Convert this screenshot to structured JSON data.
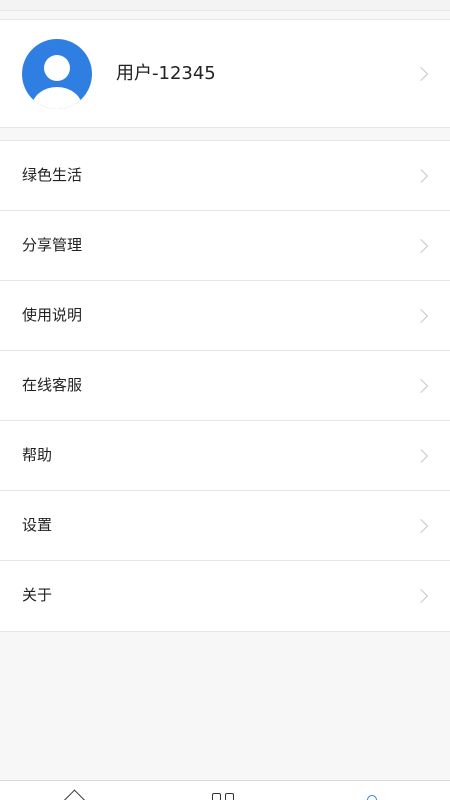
{
  "profile": {
    "username": "用户-12345",
    "avatar_color": "#2f7fe3"
  },
  "menu": {
    "items": [
      {
        "label": "绿色生活"
      },
      {
        "label": "分享管理"
      },
      {
        "label": "使用说明"
      },
      {
        "label": "在线客服"
      },
      {
        "label": "帮助"
      },
      {
        "label": "设置"
      },
      {
        "label": "关于"
      }
    ]
  },
  "tabbar": {
    "tabs": [
      {
        "icon": "home-icon"
      },
      {
        "icon": "category-icon"
      },
      {
        "icon": "profile-icon",
        "active": true,
        "active_color": "#2f7fe3"
      }
    ]
  }
}
